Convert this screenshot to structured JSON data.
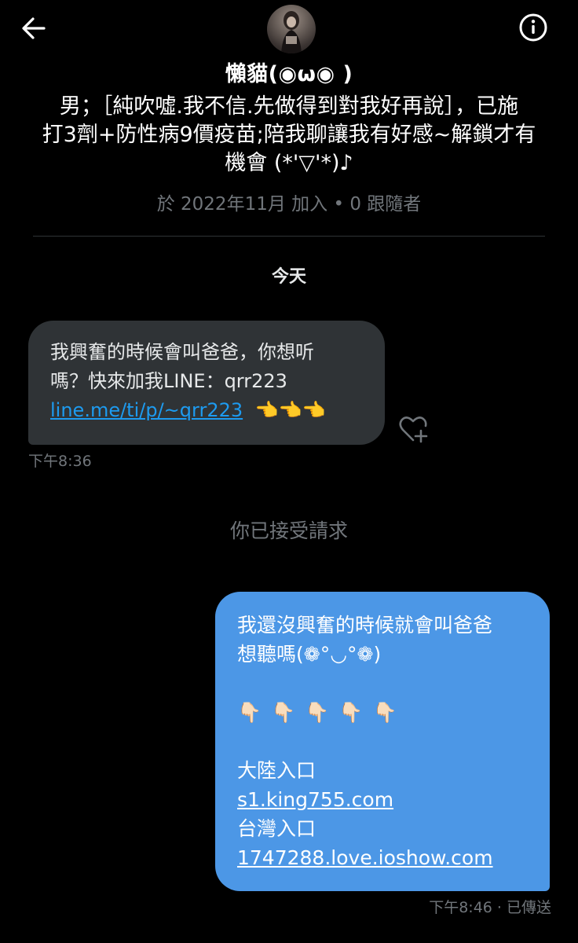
{
  "header": {
    "display_name": "懶貓(◉ω◉ )"
  },
  "profile": {
    "bio_lines": [
      "男；［純吹噓.我不信.先做得到對我好再說］，已施",
      "打3劑+防性病9價疫苗;陪我聊讓我有好感~解鎖才有",
      "機會 (*'▽'*)♪"
    ],
    "joined": "於 2022年11月 加入 • 0 跟隨者"
  },
  "conversation": {
    "day_label": "今天",
    "incoming": {
      "lines": [
        "我興奮的時候會叫爸爸，你想听",
        "嗎？快來加我LINE：qrr223"
      ],
      "link": "line.me/ti/p/~qrr223",
      "emoji": "👈👈👈",
      "time": "下午8:36"
    },
    "system_note": "你已接受請求",
    "outgoing": {
      "line1": "我還沒興奮的時候就會叫爸爸",
      "line2": "想聽嗎(❁°◡°❁)",
      "hands": [
        "👇🏻",
        "👇🏻",
        "👇🏻",
        "👇🏻",
        "👇🏻"
      ],
      "label1": "大陸入口",
      "link1": "s1.king755.com",
      "label2": "台灣入口",
      "link2": "1747288.love.ioshow.com",
      "status": "下午8:46 · 已傳送"
    }
  },
  "colors": {
    "background": "#000000",
    "incoming_bubble": "#2f3336",
    "outgoing_bubble": "#4c97e6",
    "link": "#1d9bf0",
    "muted_text": "#71767b"
  },
  "icons": [
    "arrow-left-icon",
    "info-icon",
    "heart-add-icon"
  ]
}
